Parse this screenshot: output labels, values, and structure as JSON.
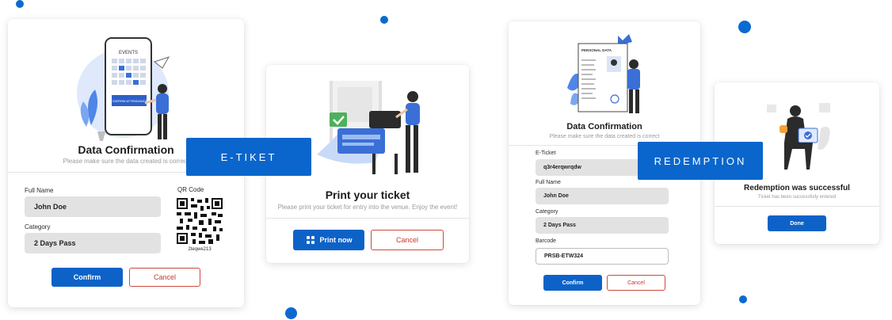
{
  "ribbons": {
    "eticket": "E-TIKET",
    "redemption": "REDEMPTION"
  },
  "confirm_card": {
    "illustration_text": {
      "events": "EVENTS",
      "confirm": "CONFIRM ATTENDANCE"
    },
    "title": "Data Confirmation",
    "subtitle": "Please make sure the data created is correct",
    "full_name_label": "Full Name",
    "full_name_value": "John Doe",
    "category_label": "Category",
    "category_value": "2 Days Pass",
    "qr_label": "QR Code",
    "qr_code_text": "2teqwe213",
    "confirm_button": "Confirm",
    "cancel_button": "Cancel"
  },
  "print_card": {
    "title": "Print your ticket",
    "subtitle": "Please print your ticket for entry into the venue. Enjoy the event!",
    "print_button": "Print now",
    "cancel_button": "Cancel"
  },
  "redemption_confirm_card": {
    "illustration_text": {
      "personal": "PERSONAL DATA"
    },
    "title": "Data Confirmation",
    "subtitle": "Please make sure the data created is correct",
    "eticket_label": "E-Ticket",
    "eticket_value": "q3r4erqwrqdw",
    "full_name_label": "Full Name",
    "full_name_value": "John Doe",
    "category_label": "Category",
    "category_value": "2 Days Pass",
    "barcode_label": "Barcode",
    "barcode_value": "PRSB-ETW324",
    "confirm_button": "Confirm",
    "cancel_button": "Cancel"
  },
  "success_card": {
    "title": "Redemption was successful",
    "subtitle": "Ticket has been successfully entered",
    "done_button": "Done"
  },
  "colors": {
    "primary": "#0d62c8",
    "cancel": "#c8372b",
    "field_bg": "#e2e2e2",
    "dot": "#0a6ad0"
  },
  "icons": [
    "print-icon",
    "check-icon",
    "qr-code-icon",
    "paper-plane-icon"
  ]
}
